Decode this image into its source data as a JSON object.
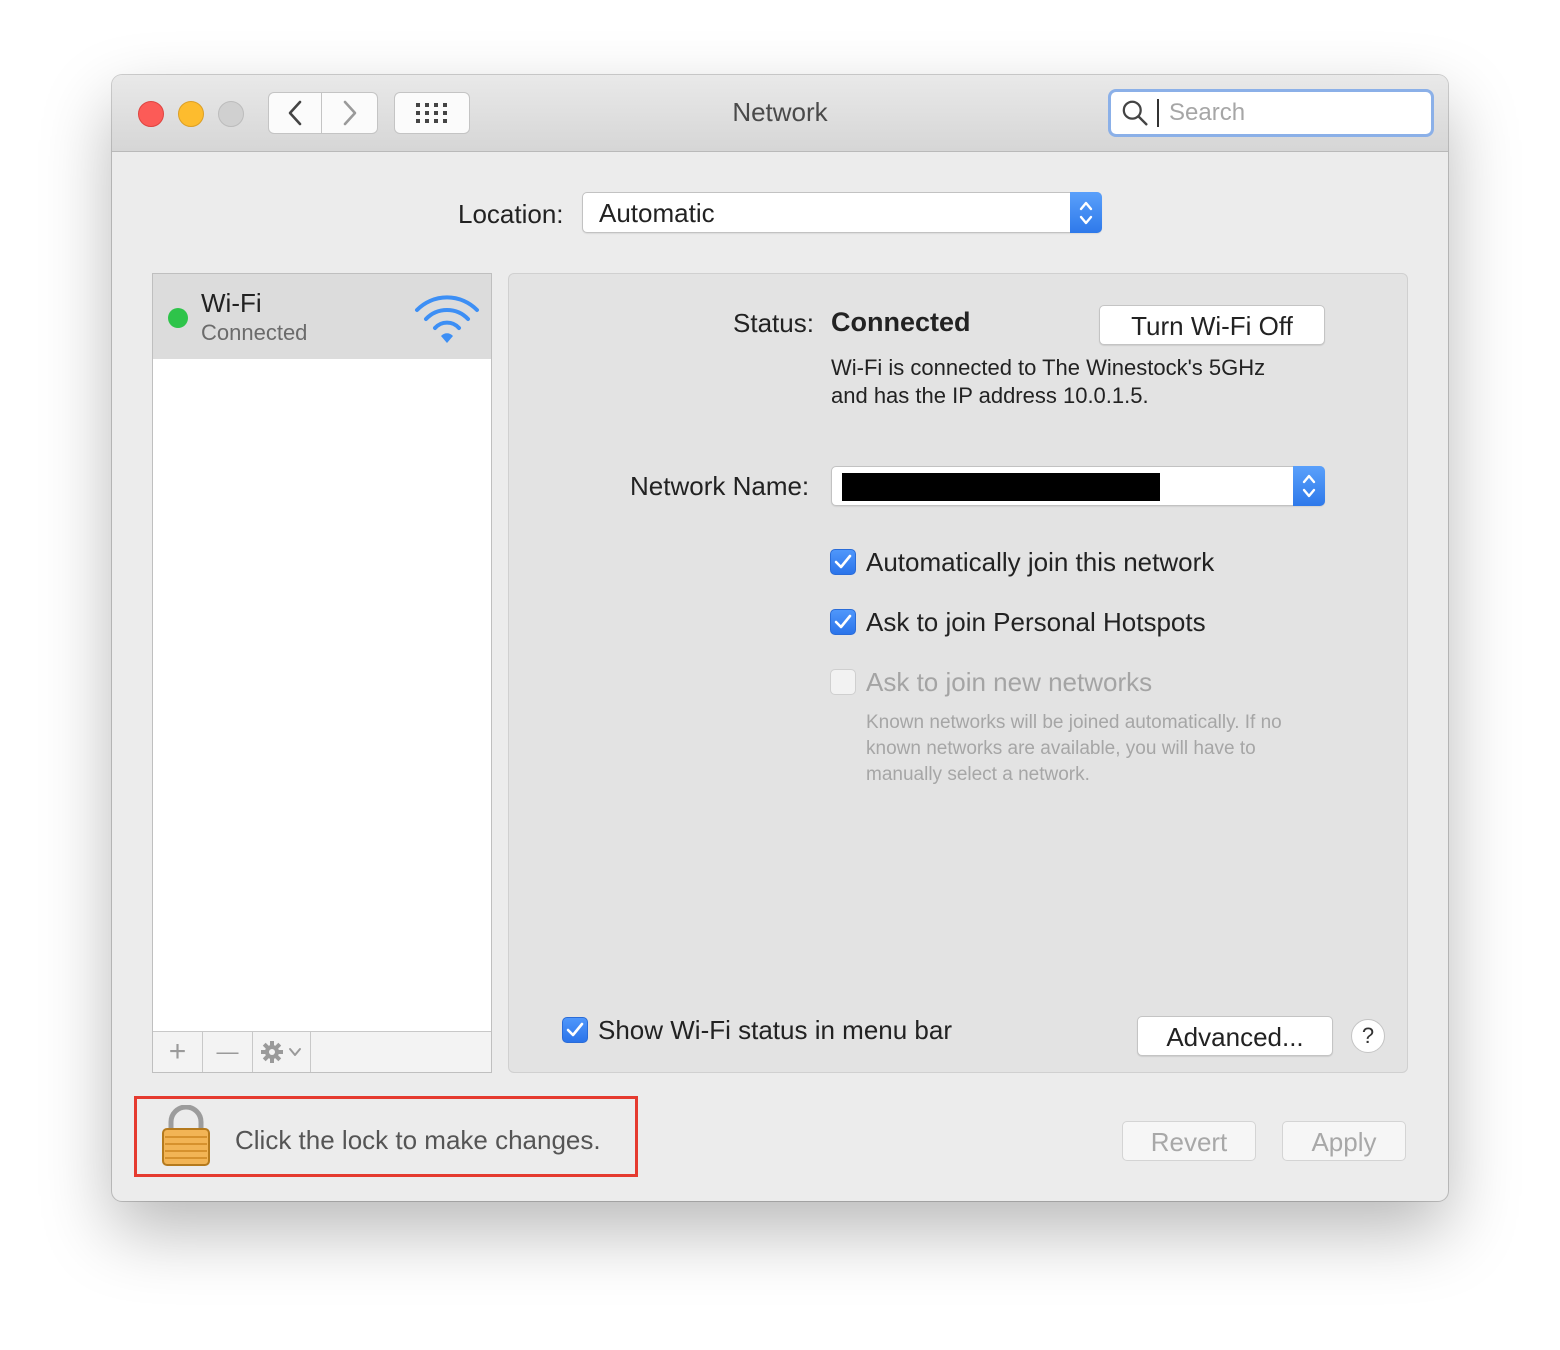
{
  "window": {
    "title": "Network"
  },
  "toolbar": {
    "back_icon": "chevron-left-icon",
    "forward_icon": "chevron-right-icon",
    "grid_icon": "grid-icon",
    "search": {
      "placeholder": "Search",
      "value": ""
    }
  },
  "location": {
    "label": "Location:",
    "value": "Automatic"
  },
  "sidebar": {
    "services": [
      {
        "name": "Wi-Fi",
        "status": "Connected",
        "status_color": "#2ec44a",
        "icon": "wifi-icon"
      }
    ],
    "toolbar": {
      "add": "+",
      "remove": "—"
    }
  },
  "detail": {
    "status_label": "Status:",
    "status_value": "Connected",
    "turn_off_button": "Turn Wi-Fi Off",
    "status_desc_line1": "Wi-Fi is connected to The Winestock's 5GHz",
    "status_desc_line2": "and has the IP address 10.0.1.5.",
    "network_name_label": "Network Name:",
    "checkboxes": [
      {
        "label": "Automatically join this network",
        "checked": true,
        "enabled": true
      },
      {
        "label": "Ask to join Personal Hotspots",
        "checked": true,
        "enabled": true
      },
      {
        "label": "Ask to join new networks",
        "checked": false,
        "enabled": false
      }
    ],
    "help_text": "Known networks will be joined automatically. If no known networks are available, you will have to manually select a network.",
    "show_status_label": "Show Wi-Fi status in menu bar",
    "show_status_checked": true,
    "advanced_button": "Advanced...",
    "help_button": "?"
  },
  "footer": {
    "lock_text": "Click the lock to make changes.",
    "revert_button": "Revert",
    "apply_button": "Apply"
  },
  "colors": {
    "accent": "#2e79ea",
    "highlight_box": "#e53a2f"
  }
}
